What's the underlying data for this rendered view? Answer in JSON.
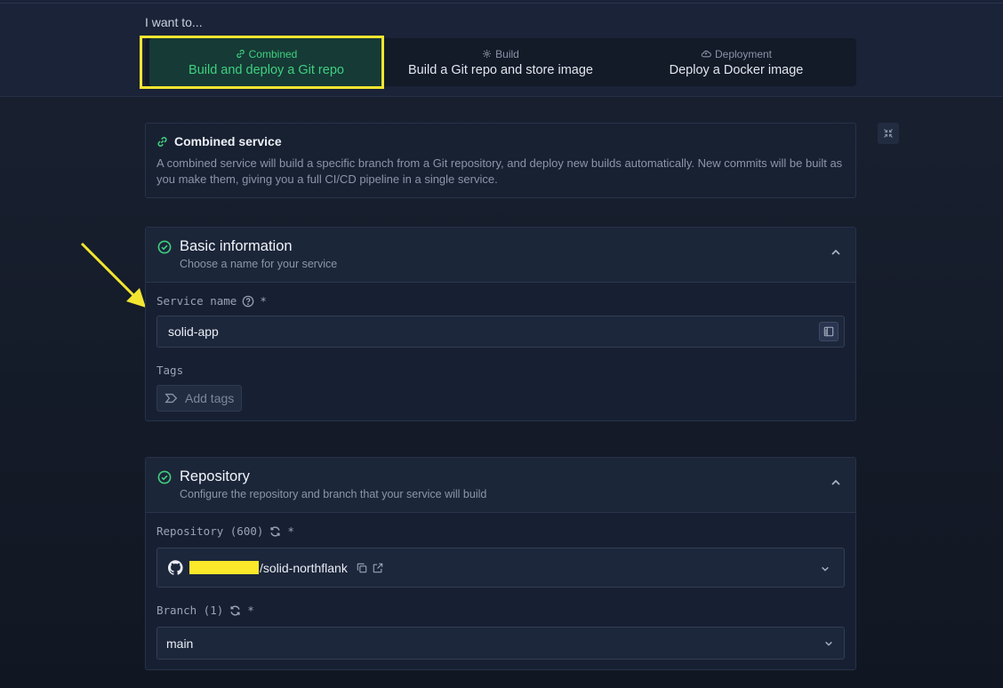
{
  "header": {
    "prompt": "I want to..."
  },
  "service_types": [
    {
      "small": "Combined",
      "big": "Build and deploy a Git repo",
      "icon": "link-icon",
      "active": true
    },
    {
      "small": "Build",
      "big": "Build a Git repo and store image",
      "icon": "gear-icon",
      "active": false
    },
    {
      "small": "Deployment",
      "big": "Deploy a Docker image",
      "icon": "cloud-icon",
      "active": false
    }
  ],
  "info": {
    "title": "Combined service",
    "description": "A combined service will build a specific branch from a Git repository, and deploy new builds automatically. New commits will be built as you make them, giving you a full CI/CD pipeline in a single service."
  },
  "basic": {
    "title": "Basic information",
    "subtitle": "Choose a name for your service",
    "service_name_label": "Service name",
    "required": "*",
    "service_name_value": "solid-app",
    "tags_label": "Tags",
    "tags_placeholder": "Add tags"
  },
  "repository": {
    "title": "Repository",
    "subtitle": "Configure the repository and branch that your service will build",
    "repo_label": "Repository (600)",
    "required": "*",
    "repo_value": "/solid-northflank",
    "branch_label": "Branch (1)",
    "branch_value": "main"
  },
  "colors": {
    "accent": "#3fd07f",
    "highlight": "#f3e630"
  }
}
